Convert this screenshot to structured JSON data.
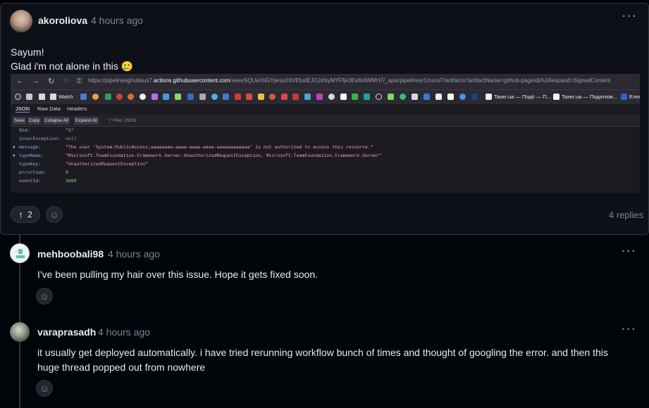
{
  "main_comment": {
    "author": "akoroliova",
    "time": "4 hours ago",
    "line1": "Sayum!",
    "line2": "Glad i'm not alone in this 🥲",
    "upvote_count": "2",
    "replies": "4 replies",
    "screenshot": {
      "url_prefix": "https://pipelinesghubeus7.",
      "url_host": "actions.githubusercontent.com",
      "url_rest": "/seeeSQUeXIiGYjenjv03VEbsIEJOJzNyMYFfje3EebI4WMH7/_apis/pipelines/1/runs/7/artifacts?artifactName=github-pages&%24expand=SignedContent",
      "bookmarks": {
        "watch": "Watch",
        "taxer1": "Taxer.ua — Події — П...",
        "taxer2": "Taxer.ua — Податков...",
        "elektro": "Електро"
      },
      "tabs": [
        "JSON",
        "Raw Data",
        "Headers"
      ],
      "buttons": [
        "Save",
        "Copy",
        "Collapse All",
        "Expand All"
      ],
      "filter": "Filter JSON",
      "json_rows": [
        {
          "key": "$id:",
          "val": "\"1\""
        },
        {
          "key": "innerException:",
          "val": "null"
        },
        {
          "key": "message:",
          "val": "\"The user 'System:PublicAccess;aaaaaaaa-aaaa-aaaa-aaaa-aaaaaaaaaaaa' is not authorized to access this resource.\""
        },
        {
          "key": "typeName:",
          "val": "\"Microsoft.TeamFoundation.Framework.Server.UnauthorizedRequestException, Microsoft.TeamFoundation.Framework.Server\""
        },
        {
          "key": "typeKey:",
          "val": "\"UnauthorizedRequestException\""
        },
        {
          "key": "errorCode:",
          "val": "0"
        },
        {
          "key": "eventId:",
          "val": "3000"
        }
      ]
    }
  },
  "replies_list": [
    {
      "author": "mehboobali98",
      "time": "4 hours ago",
      "body_line1": "I've been pulling my hair over this issue. Hope it gets fixed soon.",
      "body_line2": ""
    },
    {
      "author": "varaprasadh",
      "time": "4 hours ago",
      "body_line1": "it usually get deployed automatically. i have tried rerunning workflow bunch of times and thought of googling the error. and then this",
      "body_line2": "huge thread popped out from nowhere"
    }
  ],
  "colors": {
    "background": "#010409",
    "card": "#0d1117",
    "border": "#30363d",
    "muted": "#7d8590",
    "text": "#e6edf3"
  }
}
